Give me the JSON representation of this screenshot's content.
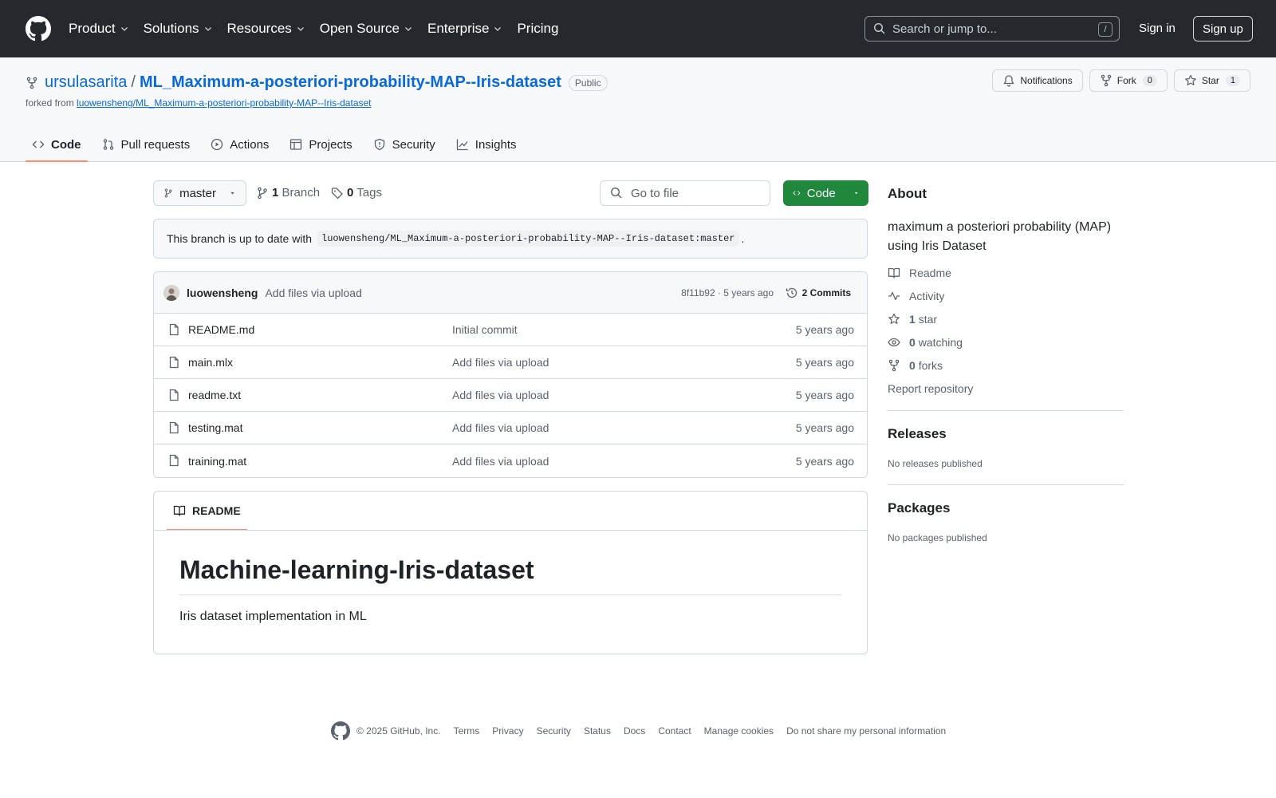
{
  "header": {
    "nav": [
      "Product",
      "Solutions",
      "Resources",
      "Open Source",
      "Enterprise",
      "Pricing"
    ],
    "search_placeholder": "Search or jump to...",
    "search_shortcut": "/",
    "sign_in": "Sign in",
    "sign_up": "Sign up"
  },
  "repo": {
    "owner": "ursulasarita",
    "separator": "/",
    "name": "ML_Maximum-a-posteriori-probability-MAP--Iris-dataset",
    "visibility": "Public",
    "forked_prefix": "forked from",
    "forked_from": "luowensheng/ML_Maximum-a-posteriori-probability-MAP--Iris-dataset",
    "notifications": "Notifications",
    "fork_label": "Fork",
    "fork_count": "0",
    "star_label": "Star",
    "star_count": "1"
  },
  "tabs": [
    "Code",
    "Pull requests",
    "Actions",
    "Projects",
    "Security",
    "Insights"
  ],
  "toolbar": {
    "branch": "master",
    "branch_count": "1",
    "branch_label": "Branch",
    "tag_count": "0",
    "tag_label": "Tags",
    "goto_placeholder": "Go to file",
    "code_button": "Code"
  },
  "uptodate": {
    "text": "This branch is up to date with",
    "ref": "luowensheng/ML_Maximum-a-posteriori-probability-MAP--Iris-dataset:master",
    "end": "."
  },
  "latest_commit": {
    "user": "luowensheng",
    "message": "Add files via upload",
    "hash_time": "8f11b92 · 5 years ago",
    "commits": "2 Commits"
  },
  "files": [
    {
      "name": "README.md",
      "commit": "Initial commit",
      "age": "5 years ago"
    },
    {
      "name": "main.mlx",
      "commit": "Add files via upload",
      "age": "5 years ago"
    },
    {
      "name": "readme.txt",
      "commit": "Add files via upload",
      "age": "5 years ago"
    },
    {
      "name": "testing.mat",
      "commit": "Add files via upload",
      "age": "5 years ago"
    },
    {
      "name": "training.mat",
      "commit": "Add files via upload",
      "age": "5 years ago"
    }
  ],
  "readme": {
    "tab": "README",
    "title": "Machine-learning-Iris-dataset",
    "body": "Iris dataset implementation in ML"
  },
  "about": {
    "heading": "About",
    "description": "maximum a posteriori probability (MAP) using Iris Dataset",
    "readme": "Readme",
    "activity": "Activity",
    "stars_count": "1",
    "stars_label": "star",
    "watching_count": "0",
    "watching_label": "watching",
    "forks_count": "0",
    "forks_label": "forks",
    "report": "Report repository"
  },
  "releases": {
    "heading": "Releases",
    "none": "No releases published"
  },
  "packages": {
    "heading": "Packages",
    "none": "No packages published"
  },
  "footer": {
    "copyright": "© 2025 GitHub, Inc.",
    "links": [
      "Terms",
      "Privacy",
      "Security",
      "Status",
      "Docs",
      "Contact",
      "Manage cookies",
      "Do not share my personal information"
    ]
  },
  "colors": {
    "header_bg": "#25292e",
    "link": "#0969da",
    "code_btn": "#1f883d",
    "tab_underline": "#fd8c73"
  }
}
